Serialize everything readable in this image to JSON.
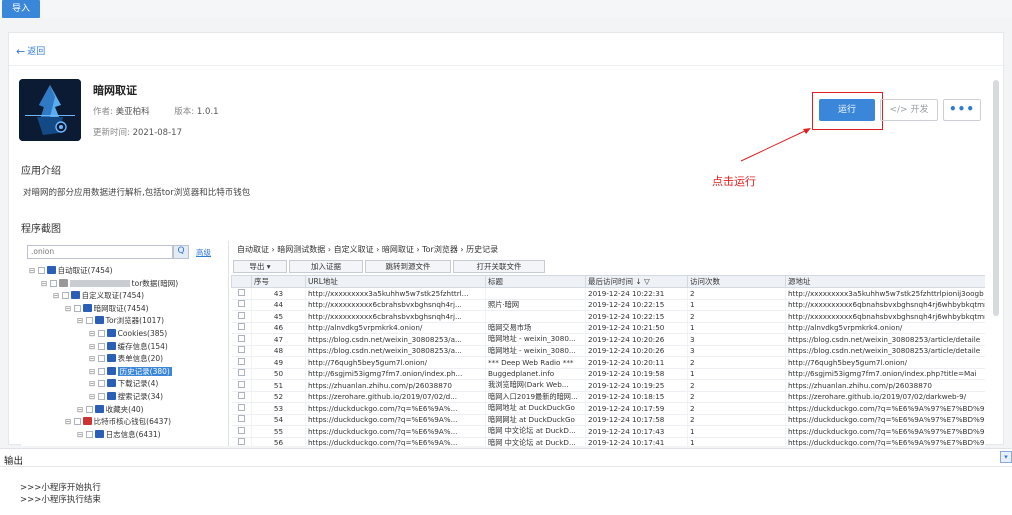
{
  "topbar": {
    "import_label": "导入"
  },
  "back": {
    "label": "返回"
  },
  "app": {
    "name": "暗网取证",
    "author_label": "作者:",
    "author": "美亚柏科",
    "version_label": "版本:",
    "version": "1.0.1",
    "updated_label": "更新时间:",
    "updated": "2021-08-17"
  },
  "actions": {
    "run": "运行",
    "dev": "开发",
    "more": "•••"
  },
  "annotation": "点击运行",
  "intro": {
    "title": "应用介绍",
    "text": "对暗网的部分应用数据进行解析,包括tor浏览器和比特币钱包"
  },
  "screenshots": {
    "title": "程序截图"
  },
  "tree": {
    "search_value": ".onion",
    "search_button": "Q",
    "advanced": "高级",
    "nodes": [
      {
        "label": "自动取证(7454)",
        "indent": 0,
        "icon": "blue"
      },
      {
        "label": "tor数据(暗网)",
        "indent": 1,
        "icon": "gray",
        "blurred": true
      },
      {
        "label": "自定义取证(7454)",
        "indent": 2,
        "icon": "blue"
      },
      {
        "label": "暗网取证(7454)",
        "indent": 3,
        "icon": "blue"
      },
      {
        "label": "Tor浏览器(1017)",
        "indent": 4,
        "icon": "blue"
      },
      {
        "label": "Cookies(385)",
        "indent": 5,
        "icon": "blue"
      },
      {
        "label": "缓存信息(154)",
        "indent": 5,
        "icon": "blue"
      },
      {
        "label": "表单信息(20)",
        "indent": 5,
        "icon": "blue"
      },
      {
        "label": "历史记录(380)",
        "indent": 5,
        "icon": "blue",
        "selected": true
      },
      {
        "label": "下载记录(4)",
        "indent": 5,
        "icon": "blue"
      },
      {
        "label": "搜索记录(34)",
        "indent": 5,
        "icon": "blue"
      },
      {
        "label": "收藏夹(40)",
        "indent": 4,
        "icon": "blue"
      },
      {
        "label": "比特币核心钱包(6437)",
        "indent": 3,
        "icon": "red"
      },
      {
        "label": "日志信息(6431)",
        "indent": 4,
        "icon": "blue"
      }
    ]
  },
  "breadcrumb": "自动取证  ›  暗网测试数据  ›  自定义取证  ›  暗网取证  ›  Tor浏览器  ›  历史记录",
  "toolbar": {
    "export": "导出 ▾",
    "add_evidence": "加入证据",
    "jump_source": "跳转到源文件",
    "open_related": "打开关联文件"
  },
  "table": {
    "columns": [
      "",
      "序号",
      "URL地址",
      "标题",
      "最后访问时间  ↓ ▽",
      "访问次数",
      "源地址"
    ],
    "rows": [
      [
        "43",
        "http://xxxxxxxxx3a5kuhhw5w7stk25fzhttrl...",
        "",
        "2019-12-24 10:22:31",
        "2",
        "http://xxxxxxxxx3a5kuhhw5w7stk25fzhttrlpionij3oogb"
      ],
      [
        "44",
        "http://xxxxxxxxxx6cbrahsbvxbghsnqh4rj...",
        "照片·暗网",
        "2019-12-24 10:22:15",
        "1",
        "http://xxxxxxxxxx6qbnahsbvxbghsnqh4rj6whbybkqtmm"
      ],
      [
        "45",
        "http://xxxxxxxxxx6cbrahsbvxbghsnqh4rj...",
        "",
        "2019-12-24 10:22:15",
        "2",
        "http://xxxxxxxxxx6qbnahsbvxbghsnqh4rj6whbybkqtmm"
      ],
      [
        "46",
        "http://alnvdkg5vrpmkrk4.onion/",
        "暗网交易市场",
        "2019-12-24 10:21:50",
        "1",
        "http://alnvdkg5vrpmkrk4.onion/"
      ],
      [
        "47",
        "https://blog.csdn.net/weixin_30808253/a...",
        "暗网地址 - weixin_3080...",
        "2019-12-24 10:20:26",
        "3",
        "https://blog.csdn.net/weixin_30808253/article/detaile"
      ],
      [
        "48",
        "https://blog.csdn.net/weixin_30808253/a...",
        "暗网地址 - weixin_3080...",
        "2019-12-24 10:20:26",
        "3",
        "https://blog.csdn.net/weixin_30808253/article/detaile"
      ],
      [
        "49",
        "http://76qugh5bey5gum7l.onion/",
        "*** Deep Web Radio ***",
        "2019-12-24 10:20:11",
        "2",
        "http://76qugh5bey5gum7l.onion/"
      ],
      [
        "50",
        "http://6sgjmi53igmg7fm7.onion/index.ph...",
        "Buggedplanet.info",
        "2019-12-24 10:19:58",
        "1",
        "http://6sgjmi53igmg7fm7.onion/index.php?title=Mai"
      ],
      [
        "51",
        "https://zhuanlan.zhihu.com/p/26038870",
        "我浏览暗网(Dark Web...",
        "2019-12-24 10:19:25",
        "2",
        "https://zhuanlan.zhihu.com/p/26038870"
      ],
      [
        "52",
        "https://zerohare.github.io/2019/07/02/d...",
        "暗网入口2019最新的暗网...",
        "2019-12-24 10:18:15",
        "2",
        "https://zerohare.github.io/2019/07/02/darkweb-9/"
      ],
      [
        "53",
        "https://duckduckgo.com/?q=%E6%9A%...",
        "暗网地址 at DuckDuckGo",
        "2019-12-24 10:17:59",
        "2",
        "https://duckduckgo.com/?q=%E6%9A%97%E7%BD%9"
      ],
      [
        "54",
        "https://duckduckgo.com/?q=%E6%9A%...",
        "暗网网址 at DuckDuckGo",
        "2019-12-24 10:17:58",
        "2",
        "https://duckduckgo.com/?q=%E6%9A%97%E7%BD%9"
      ],
      [
        "55",
        "https://duckduckgo.com/?q=%E6%9A%...",
        "暗网 中文论坛 at DuckD...",
        "2019-12-24 10:17:43",
        "1",
        "https://duckduckgo.com/?q=%E6%9A%97%E7%BD%9"
      ],
      [
        "56",
        "https://duckduckgo.com/?q=%E6%9A%...",
        "暗网 中文论坛 at DuckD...",
        "2019-12-24 10:17:41",
        "1",
        "https://duckduckgo.com/?q=%E6%9A%97%E7%BD%9"
      ]
    ]
  },
  "output": {
    "title": "输出",
    "toggle": "▾",
    "lines": [
      ">>>小程序开始执行",
      ">>>小程序执行结束"
    ]
  }
}
